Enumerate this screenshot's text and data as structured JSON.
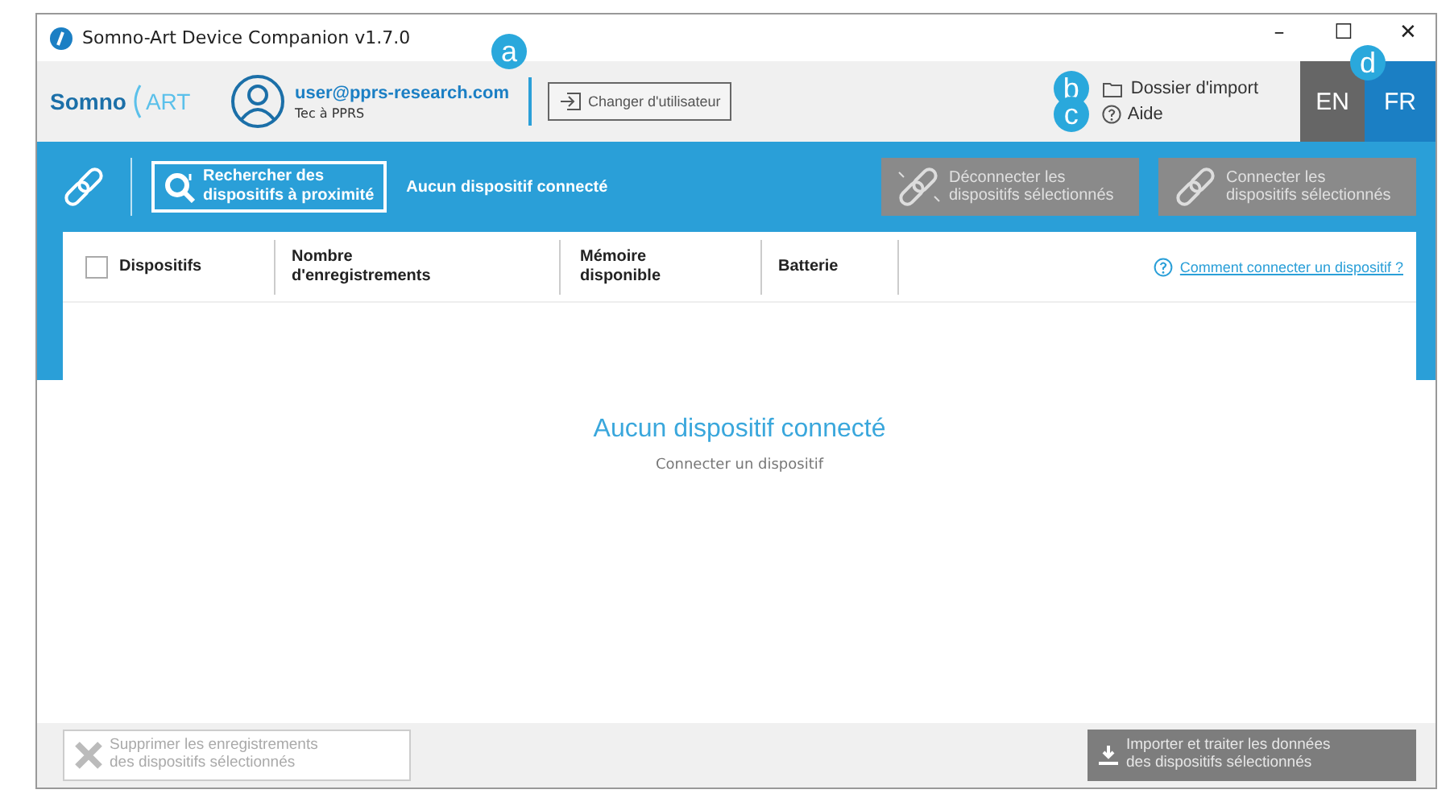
{
  "window": {
    "title": "Somno-Art Device Companion v1.7.0",
    "controls": [
      "–",
      "☐",
      "✕"
    ]
  },
  "header": {
    "logo": {
      "left": "Somno",
      "right": "ART"
    },
    "user": {
      "email": "user@pprs-research.com",
      "org": "Tec à PPRS",
      "callout": "a"
    },
    "switch_user": "Changer d'utilisateur",
    "links": [
      {
        "kind": "folder",
        "label": "Dossier d'import",
        "callout": "b"
      },
      {
        "kind": "help",
        "label": "Aide",
        "callout": "c"
      }
    ],
    "languages": [
      {
        "label": "EN",
        "selected": false
      },
      {
        "label": "FR",
        "selected": true
      }
    ],
    "languages_callout": "d"
  },
  "toolbar": {
    "search": "Rechercher des\ndispositifs à proximité",
    "status": "Aucun dispositif connecté",
    "actions": [
      {
        "label": "Déconnecter les\ndispositifs sélectionnés",
        "disabled": true,
        "kind": "disconnect"
      },
      {
        "label": "Connecter les\ndispositifs sélectionnés",
        "disabled": true,
        "kind": "connect"
      }
    ]
  },
  "table": {
    "select_all": {
      "checked": false
    },
    "columns": [
      "Dispositifs",
      "Nombre\nd'enregistrements",
      "Mémoire\ndisponible",
      "Batterie"
    ],
    "help_link": "Comment connecter un dispositif ?"
  },
  "empty": {
    "title": "Aucun dispositif connecté",
    "subtitle": "Connecter un dispositif"
  },
  "footer": {
    "buttons": [
      {
        "kind": "delete",
        "label": "Supprimer les enregistrements\ndes dispositifs sélectionnés",
        "disabled": true
      },
      {
        "kind": "import",
        "label": "Importer et traiter les données\ndes dispositifs sélectionnés",
        "disabled": true
      }
    ]
  }
}
